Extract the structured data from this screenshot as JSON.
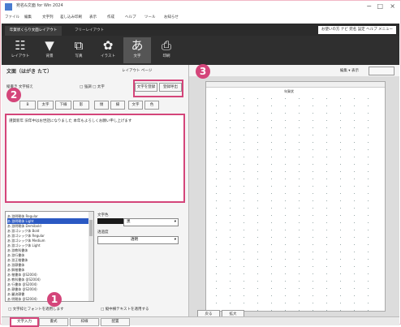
{
  "window": {
    "title": "宛名&文面 for Win 2024",
    "controls": [
      "−",
      "□",
      "×"
    ]
  },
  "menu": {
    "items": [
      "ファイル",
      "編集",
      "文字列",
      "差し込み印刷",
      "表示",
      "作成",
      "ヘルプ",
      "ツール",
      "お知らせ"
    ]
  },
  "top_tabs": {
    "items": [
      {
        "label": "年賀状くらり文面レイアウト"
      },
      {
        "label": "フリーレイアウト"
      }
    ],
    "right_links": "お使いの方  ナビ  宛名  設定  ヘルプ  メニュー"
  },
  "ribbon": {
    "buttons": [
      {
        "label": "レイアウト",
        "icon": "layout-icon",
        "glyph": "☷"
      },
      {
        "label": "背景",
        "icon": "background-icon",
        "glyph": "▼"
      },
      {
        "label": "写真",
        "icon": "photo-icon",
        "glyph": "⧉"
      },
      {
        "label": "イラスト",
        "icon": "illust-icon",
        "glyph": "✿"
      },
      {
        "label": "文字",
        "icon": "text-icon",
        "glyph": "あ"
      },
      {
        "label": "印刷",
        "icon": "print-icon",
        "glyph": "⎙"
      }
    ]
  },
  "left_panel": {
    "header": "文面（はがき たて）",
    "header_right": "レイアウト  ページ",
    "row1_left": "縦書き  文字揃え",
    "row1_mid": "□ 強調  □ 太字",
    "buttons_area_label": "文字装飾",
    "format_buttons": [
      "B",
      "太字",
      "下線",
      "影",
      "傾",
      "縁",
      "文字",
      "色"
    ],
    "save_buttons": [
      "文字を登録",
      "登録呼出"
    ],
    "textarea_content": "謹賀新年 旧年中はお世話になりました 本年もよろしくお願い申し上げます",
    "font_rows": [
      "あ 游明朝体 Regular",
      "あ 游明朝体 Light",
      "あ 游明朝体 Demibold",
      "あ 游ゴシック体 Bold",
      "あ 游ゴシック体 Regular",
      "あ 游ゴシック体 Medium",
      "あ 游ゴシック体 Light",
      "あ 游教科書体",
      "あ 游行書体",
      "あ 游正楷書体",
      "あ 游隷書体",
      "あ 解楷書体",
      "あ 楷書体 (JIS2004)",
      "あ 教科書体 (JIS2004)",
      "あ 行書体 (JIS2004)",
      "あ 隷書体 (JIS2004)",
      "あ 麗流隷書",
      "あ 明朝体 (JIS2004)",
      "あ ゴシック"
    ],
    "color_label": "文字色",
    "color_value": "黒",
    "opacity_label": "透過度",
    "opacity_value": "透明",
    "checkbox_label": "縦中横テキストを適用する",
    "checkbox2_label": "□ 文字枠とフォントを適用します"
  },
  "bottom_tabs": [
    "文字入力",
    "書式",
    "枠線",
    "配置"
  ],
  "right_panel": {
    "toolbar_right": "編集  ▾  表示",
    "paper_title": "年賀状",
    "bottom_buttons": [
      "戻る",
      "拡大"
    ]
  },
  "callouts": [
    "1",
    "2",
    "3"
  ],
  "colors": {
    "accent": "#d4457a",
    "dark_bar": "#2f2f2f",
    "selected_row": "#2b59c3"
  }
}
